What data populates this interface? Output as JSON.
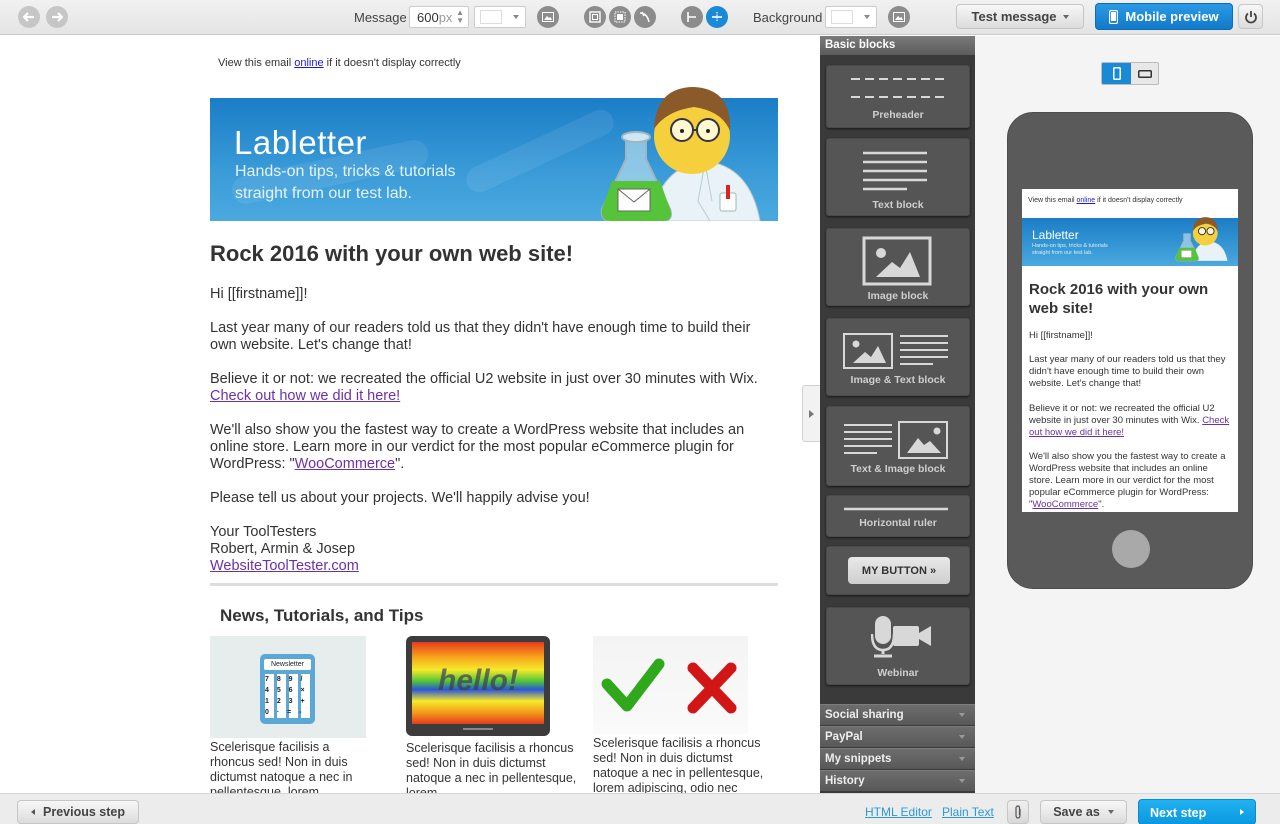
{
  "toolbar": {
    "message_label": "Message",
    "width_value": "600",
    "width_unit": "px",
    "background_label": "Background",
    "test_message_label": "Test message",
    "mobile_preview_label": "Mobile preview",
    "colors": {
      "accent": "#1a8ad6",
      "next": "#12a5ea"
    }
  },
  "email": {
    "preheader_before": "View this email ",
    "preheader_link": "online",
    "preheader_after": " if it doesn't display correctly",
    "banner_title": "Labletter",
    "banner_sub1": "Hands-on tips, tricks & tutorials",
    "banner_sub2": "straight from our test lab.",
    "headline": "Rock 2016 with your own web site!",
    "greeting": "Hi [[firstname]]!",
    "para1": "Last year many of our readers told us that they didn't have enough time to build their own website. Let's change that!",
    "para2_text": "Believe it or not: we recreated the official U2 website in just over 30 minutes with Wix. ",
    "para2_link": "Check out how we did it here!",
    "para3_text": "We'll also show you the fastest way to create a WordPress website that includes an online store. Learn more in our verdict for the most popular eCommerce plugin for WordPress: \"",
    "para3_link": "WooCommerce",
    "para3_end": "\".",
    "para4": "Please tell us about your projects. We'll happily advise you!",
    "sign1": "Your ToolTesters",
    "sign2": "Robert, Armin & Josep",
    "sign_link": "WebsiteToolTester.com",
    "section_title": "News, Tutorials, and Tips",
    "cards": [
      {
        "image": "newsletter-calculator",
        "image_caption": "Newsletter",
        "text": "Scelerisque facilisis a rhoncus sed! Non in duis dictumst natoque a nec in pellentesque, lorem"
      },
      {
        "image": "hello-tablet",
        "image_caption": "hello!",
        "text": "Scelerisque facilisis a rhoncus sed! Non in duis dictumst natoque a nec in pellentesque, lorem"
      },
      {
        "image": "check-and-cross",
        "text": "Scelerisque facilisis a rhoncus sed! Non in duis dictumst natoque a nec in pellentesque, lorem adipiscing, odio nec"
      }
    ]
  },
  "blocks_panel": {
    "title": "Basic blocks",
    "blocks": [
      {
        "label": "Preheader",
        "icon": "preheader-icon"
      },
      {
        "label": "Text block",
        "icon": "text-lines-icon"
      },
      {
        "label": "Image block",
        "icon": "image-icon"
      },
      {
        "label": "Image & Text block",
        "icon": "image-text-icon"
      },
      {
        "label": "Text & Image block",
        "icon": "text-image-icon"
      },
      {
        "label": "Horizontal ruler",
        "icon": "ruler-icon"
      },
      {
        "label": "MY BUTTON »",
        "icon": "button-icon"
      },
      {
        "label": "Webinar",
        "icon": "webinar-icon"
      }
    ],
    "sections": [
      "Social sharing",
      "PayPal",
      "My snippets",
      "History"
    ]
  },
  "preview": {
    "headline": "Rock 2016 with your own web site!"
  },
  "bottombar": {
    "previous_label": "Previous step",
    "html_editor_label": "HTML Editor",
    "plain_text_label": "Plain Text",
    "save_as_label": "Save as",
    "next_label": "Next step"
  }
}
